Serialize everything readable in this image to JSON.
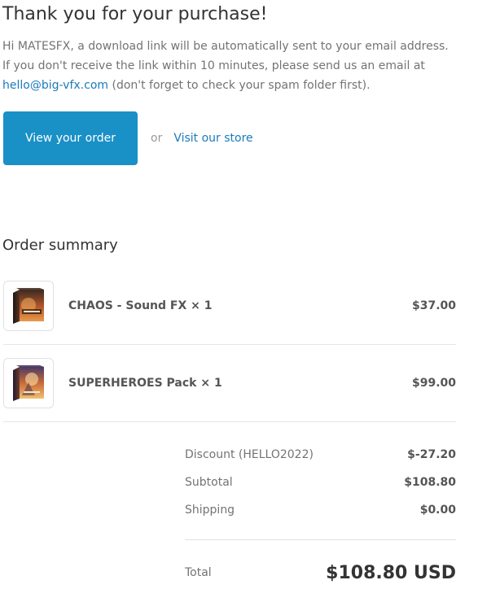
{
  "header": {
    "title": "Thank you for your purchase!",
    "intro_line1": "Hi MATESFX, a download link will be automatically sent to your email address.",
    "intro_line2": "If you don't receive the link within 10 minutes, please send us an email at",
    "email": "hello@big-vfx.com",
    "intro_line3_rest": " (don't forget to check your spam folder first)."
  },
  "actions": {
    "view_order_label": "View your order",
    "or_label": "or",
    "visit_store_label": "Visit our store"
  },
  "order_summary": {
    "heading": "Order summary",
    "items": [
      {
        "name": "CHAOS - Sound FX × 1",
        "price": "$37.00",
        "thumbnail_text": "CHAOS"
      },
      {
        "name": "SUPERHEROES Pack × 1",
        "price": "$99.00",
        "thumbnail_text": "SUPERHEROES"
      }
    ],
    "totals": {
      "discount_label": "Discount (HELLO2022)",
      "discount_value": "$-27.20",
      "subtotal_label": "Subtotal",
      "subtotal_value": "$108.80",
      "shipping_label": "Shipping",
      "shipping_value": "$0.00",
      "total_label": "Total",
      "total_value": "$108.80 USD"
    }
  },
  "colors": {
    "button_bg": "#1990c6",
    "link": "#197bbd",
    "text_dark": "#333333",
    "text_muted": "#737373"
  }
}
